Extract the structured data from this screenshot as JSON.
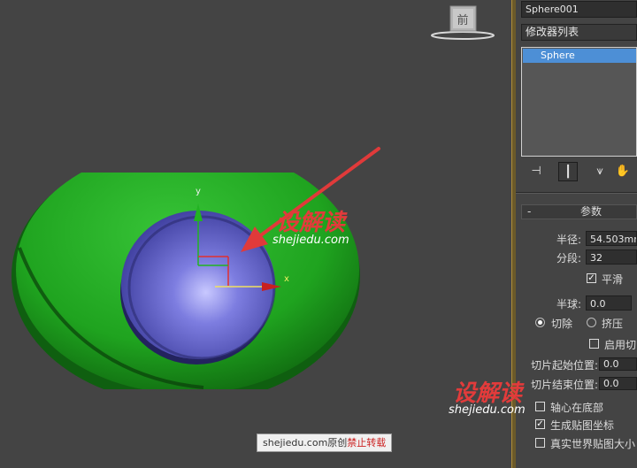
{
  "viewport": {
    "viewcube_label": "前",
    "gizmo_axis_y": "y",
    "gizmo_axis_x": "x"
  },
  "panel": {
    "object_name": "Sphere001",
    "modifier_list": "修改器列表",
    "stack_item": "Sphere",
    "rollout_title": "参数",
    "rollout_collapse": "-",
    "radius_label": "半径:",
    "radius_value": "54.503mm",
    "segments_label": "分段:",
    "segments_value": "32",
    "smooth_label": "平滑",
    "smooth_checked": true,
    "hemisphere_label": "半球:",
    "hemisphere_value": "0.0",
    "chop_label": "切除",
    "squash_label": "挤压",
    "enable_slice_label": "启用切",
    "slice_from_label": "切片起始位置:",
    "slice_from_value": "0.0",
    "slice_to_label": "切片结束位置:",
    "slice_to_value": "0.0",
    "base_to_pivot_label": "轴心在底部",
    "gen_mapping_label": "生成贴图坐标",
    "real_world_label": "真实世界贴图大小"
  },
  "watermarks": {
    "brand_cn": "设解读",
    "brand_url": "shejiedu.com",
    "credit_prefix": "shejiedu.com原创",
    "credit_warning": "禁止转载"
  },
  "colors": {
    "outer_sphere": "#1fa31f",
    "inner_sphere": "#6a6ad8",
    "arrow": "#e03a3a",
    "selection": "#4d8fd6"
  }
}
